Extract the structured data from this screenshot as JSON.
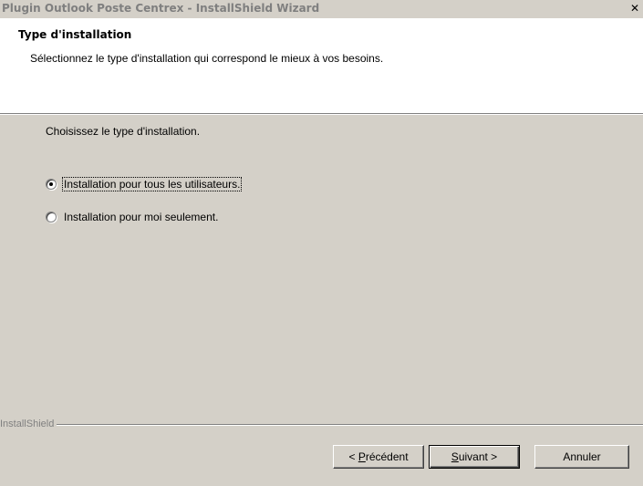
{
  "window": {
    "title": "Plugin Outlook Poste Centrex - InstallShield Wizard",
    "close_glyph": "✕"
  },
  "header": {
    "title": "Type d'installation",
    "subtitle": "Sélectionnez le type d'installation qui correspond le mieux à vos besoins."
  },
  "body": {
    "prompt": "Choisissez le type d'installation.",
    "options": [
      {
        "label": "Installation pour tous les utilisateurs.",
        "selected": true
      },
      {
        "label": "Installation pour moi seulement.",
        "selected": false
      }
    ]
  },
  "footer": {
    "brand": "InstallShield",
    "buttons": {
      "back_prefix": "< ",
      "back_mnemonic": "P",
      "back_rest": "récédent",
      "next_mnemonic": "S",
      "next_rest": "uivant >",
      "cancel": "Annuler"
    }
  },
  "colors": {
    "dialog_bg": "#d4d0c8",
    "header_bg": "#ffffff",
    "title_text_inactive": "#7f7f7f",
    "footer_brand": "#808080"
  }
}
